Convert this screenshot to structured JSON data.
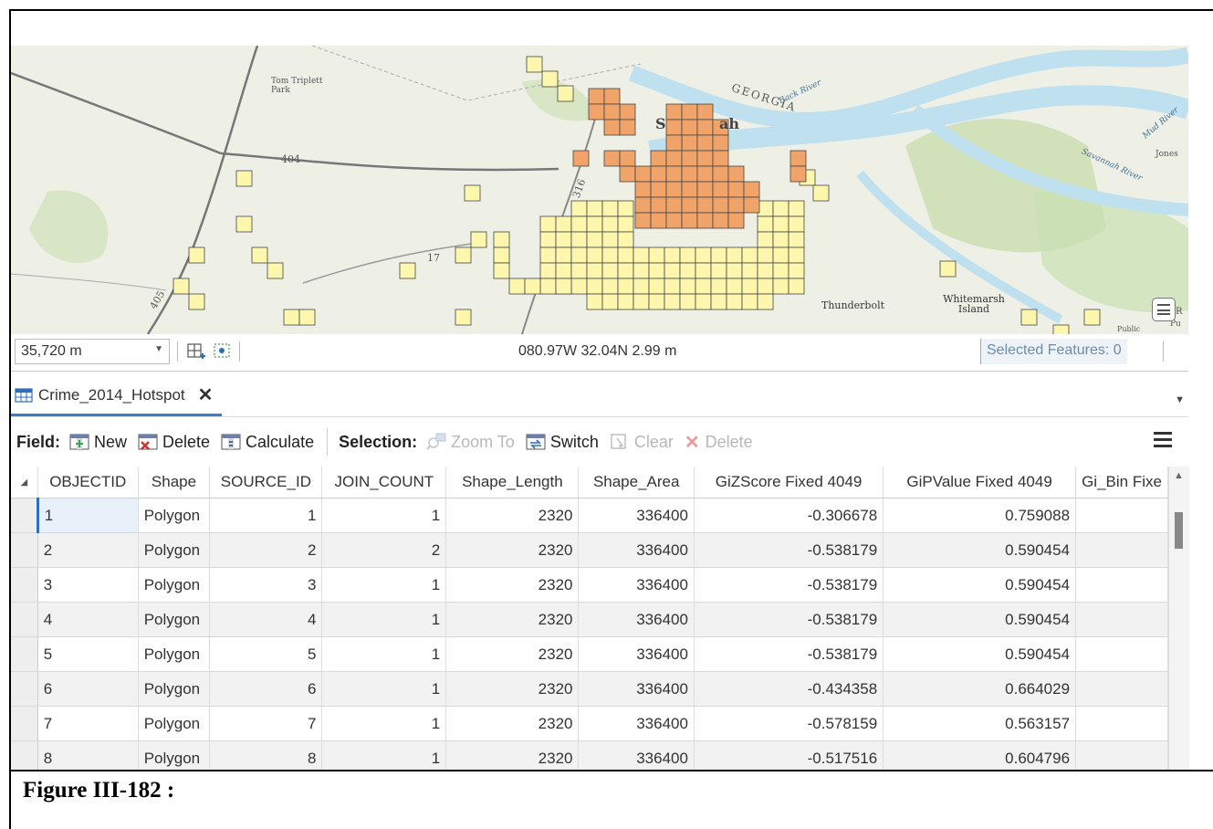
{
  "map": {
    "labels": {
      "park": "Tom Triplett Park",
      "road_404": "404",
      "road_316": "316",
      "road_405": "405",
      "road_17": "17",
      "city_partial_s": "S",
      "city_partial_ah": "ah",
      "state": "GEORGIA",
      "river_back": "Back River",
      "river_mud": "Mud River",
      "river_savannah": "Savannah River",
      "place_jones": "Jones",
      "place_thunderbolt": "Thunderbolt",
      "place_whitemarsh": "Whitemarsh Island",
      "place_public": "Public",
      "place_pu": "Pu",
      "place_r": "R"
    },
    "colors": {
      "hot": "#f0a46a",
      "neutral": "#fdf7ae",
      "water": "#bfe0ef",
      "land": "#eef0e6",
      "green": "#c9dfb0"
    }
  },
  "statusbar": {
    "scale": "35,720 m",
    "coordinates": "080.97W 32.04N  2.99 m",
    "selected_features": "Selected Features: 0"
  },
  "tab": {
    "title": "Crime_2014_Hotspot",
    "close_glyph": "✕"
  },
  "toolbar": {
    "field_label": "Field:",
    "new": "New",
    "delete_field": "Delete",
    "calculate": "Calculate",
    "selection_label": "Selection:",
    "zoom_to": "Zoom To",
    "switch": "Switch",
    "clear": "Clear",
    "delete_sel": "Delete"
  },
  "table": {
    "columns": [
      "OBJECTID",
      "Shape",
      "SOURCE_ID",
      "JOIN_COUNT",
      "Shape_Length",
      "Shape_Area",
      "GiZScore Fixed 4049",
      "GiPValue Fixed 4049",
      "Gi_Bin Fixe"
    ],
    "rows": [
      [
        "1",
        "Polygon",
        "1",
        "1",
        "2320",
        "336400",
        "-0.306678",
        "0.759088",
        ""
      ],
      [
        "2",
        "Polygon",
        "2",
        "2",
        "2320",
        "336400",
        "-0.538179",
        "0.590454",
        ""
      ],
      [
        "3",
        "Polygon",
        "3",
        "1",
        "2320",
        "336400",
        "-0.538179",
        "0.590454",
        ""
      ],
      [
        "4",
        "Polygon",
        "4",
        "1",
        "2320",
        "336400",
        "-0.538179",
        "0.590454",
        ""
      ],
      [
        "5",
        "Polygon",
        "5",
        "1",
        "2320",
        "336400",
        "-0.538179",
        "0.590454",
        ""
      ],
      [
        "6",
        "Polygon",
        "6",
        "1",
        "2320",
        "336400",
        "-0.434358",
        "0.664029",
        ""
      ],
      [
        "7",
        "Polygon",
        "7",
        "1",
        "2320",
        "336400",
        "-0.578159",
        "0.563157",
        ""
      ],
      [
        "8",
        "Polygon",
        "8",
        "1",
        "2320",
        "336400",
        "-0.517516",
        "0.604796",
        ""
      ]
    ]
  },
  "caption": "Figure III-182 :"
}
